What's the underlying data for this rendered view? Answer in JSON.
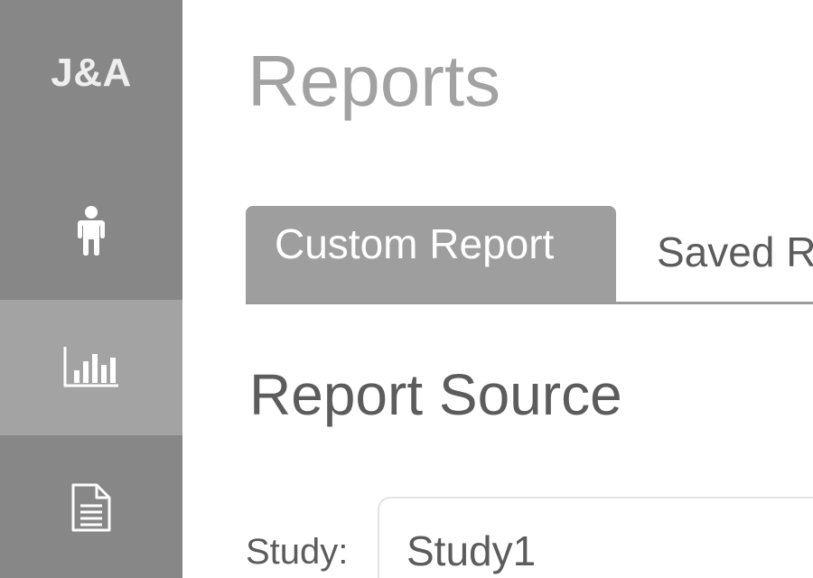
{
  "sidebar": {
    "logo_text": "J&A",
    "items": [
      {
        "icon": "person-icon",
        "active": false
      },
      {
        "icon": "bar-chart-icon",
        "active": true
      },
      {
        "icon": "document-icon",
        "active": false
      }
    ]
  },
  "main": {
    "title": "Reports",
    "tabs": [
      {
        "label": "Custom Report",
        "active": true
      },
      {
        "label": "Saved R",
        "active": false
      }
    ],
    "section_title": "Report Source",
    "study": {
      "label": "Study:",
      "value": "Study1"
    }
  },
  "colors": {
    "sidebar_bg": "#878787",
    "sidebar_active_bg": "#a3a3a3",
    "tab_active_bg": "#9e9e9e",
    "title_text": "#a2a2a2",
    "body_text": "#5c5c5c"
  }
}
